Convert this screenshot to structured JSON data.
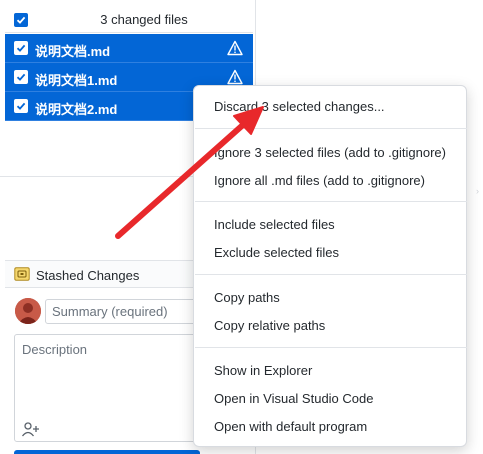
{
  "changes": {
    "header_label": "3 changed files",
    "files": [
      {
        "name": "说明文档.md"
      },
      {
        "name": "说明文档1.md"
      },
      {
        "name": "说明文档2.md"
      }
    ]
  },
  "stash": {
    "label": "Stashed Changes"
  },
  "commit": {
    "summary_placeholder": "Summary (required)",
    "description_placeholder": "Description"
  },
  "context_menu": {
    "groups": [
      [
        "Discard 3 selected changes..."
      ],
      [
        "Ignore 3 selected files (add to .gitignore)",
        "Ignore all .md files (add to .gitignore)"
      ],
      [
        "Include selected files",
        "Exclude selected files"
      ],
      [
        "Copy paths",
        "Copy relative paths"
      ],
      [
        "Show in Explorer",
        "Open in Visual Studio Code",
        "Open with default program"
      ]
    ]
  },
  "colors": {
    "selection": "#0366d6",
    "annotation_arrow": "#e8282b"
  }
}
